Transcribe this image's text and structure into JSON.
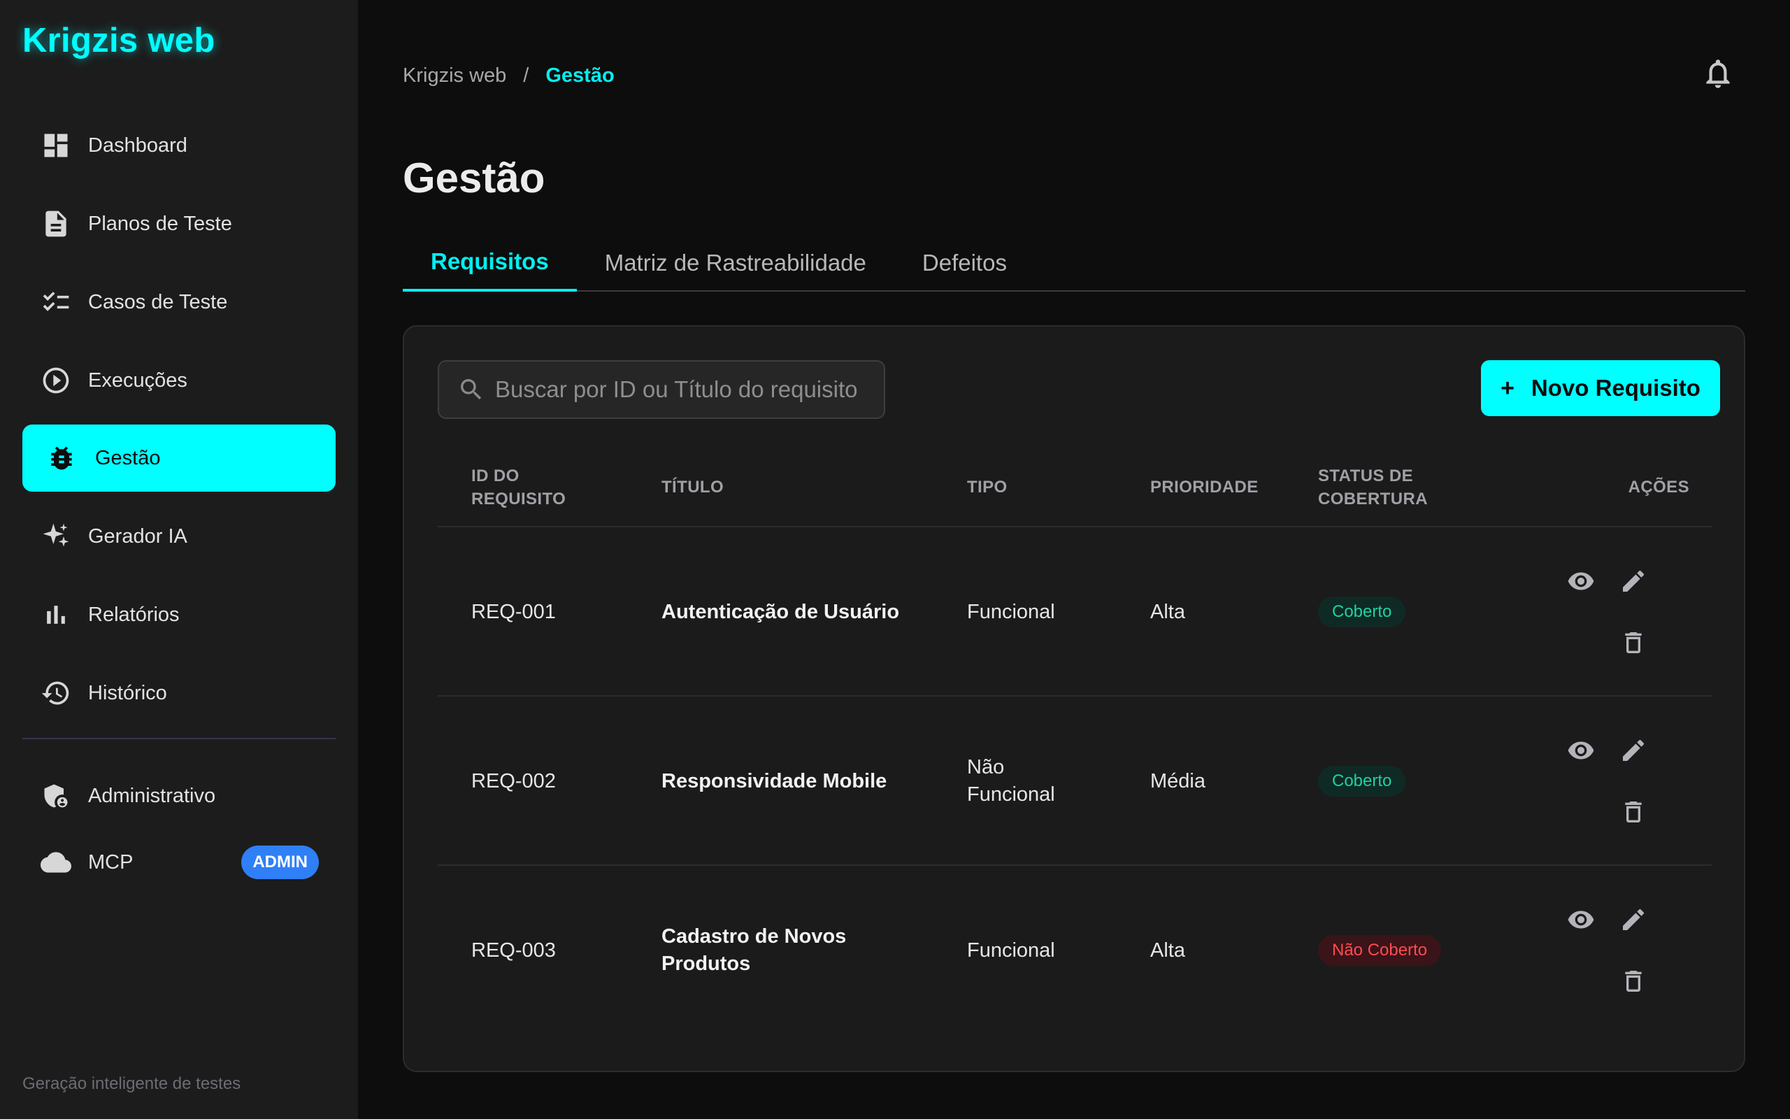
{
  "app": {
    "title": "Krigzis web"
  },
  "sidebar": {
    "items": [
      {
        "label": "Dashboard",
        "icon": "dashboard-icon"
      },
      {
        "label": "Planos de Teste",
        "icon": "document-icon"
      },
      {
        "label": "Casos de Teste",
        "icon": "checklist-icon"
      },
      {
        "label": "Execuções",
        "icon": "play-circle-icon"
      },
      {
        "label": "Gestão",
        "icon": "bug-icon",
        "active": true
      },
      {
        "label": "Gerador IA",
        "icon": "sparkles-icon"
      },
      {
        "label": "Relatórios",
        "icon": "bar-chart-icon"
      },
      {
        "label": "Histórico",
        "icon": "history-icon"
      }
    ],
    "secondary_items": [
      {
        "label": "Administrativo",
        "icon": "admin-shield-icon"
      },
      {
        "label": "MCP",
        "icon": "cloud-icon",
        "badge": "ADMIN"
      }
    ],
    "footer": "Geração inteligente de testes"
  },
  "breadcrumb": {
    "root": "Krigzis web",
    "separator": "/",
    "current": "Gestão"
  },
  "page": {
    "title": "Gestão"
  },
  "tabs": [
    {
      "label": "Requisitos",
      "active": true
    },
    {
      "label": "Matriz de Rastreabilidade"
    },
    {
      "label": "Defeitos"
    }
  ],
  "search": {
    "placeholder": "Buscar por ID ou Título do requisito",
    "value": ""
  },
  "actions": {
    "new_button_label": "Novo Requisito",
    "new_button_icon": "+"
  },
  "table": {
    "headers": {
      "id_line1": "ID DO",
      "id_line2": "REQUISITO",
      "title": "TÍTULO",
      "tipo": "TIPO",
      "prioridade": "PRIORIDADE",
      "status_line1": "STATUS DE",
      "status_line2": "COBERTURA",
      "acoes": "AÇÕES"
    },
    "rows": [
      {
        "id": "REQ-001",
        "title": "Autenticação de Usuário",
        "tipo": "Funcional",
        "prioridade": "Alta",
        "status": "Coberto"
      },
      {
        "id": "REQ-002",
        "title": "Responsividade Mobile",
        "tipo": "Não Funcional",
        "prioridade": "Média",
        "status": "Coberto"
      },
      {
        "id": "REQ-003",
        "title": "Cadastro de Novos Produtos",
        "tipo": "Funcional",
        "prioridade": "Alta",
        "status": "Não Coberto"
      }
    ]
  },
  "colors": {
    "accent": "#00ffff",
    "sidebar_bg": "#1c1c1c",
    "main_bg": "#0d0d0d",
    "card_bg": "#1b1b1b",
    "covered": "#1fd0a4",
    "not_covered": "#ff4b52",
    "admin_badge": "#2f7ff7"
  }
}
